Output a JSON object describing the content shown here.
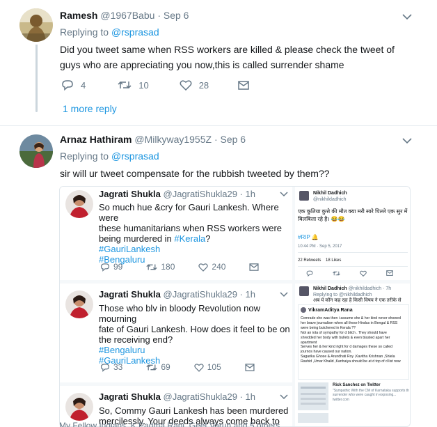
{
  "tweet1": {
    "name": "Ramesh",
    "handle": "@1967Babu",
    "date": "· Sep 6",
    "replying_prefix": "Replying to ",
    "replying_to": "@rsprasad",
    "text_line1": "Did you tweet same when RSS workers are killed & please check the tweet of",
    "text_line2": "guys who are appreciating you now,this is called surrender shame",
    "replies": "4",
    "retweets": "10",
    "likes": "28",
    "more_reply": "1 more reply"
  },
  "tweet2": {
    "name": "Arnaz Hathiram",
    "handle": "@Milkyway1955Z",
    "date": "· Sep 6",
    "replying_prefix": "Replying to ",
    "replying_to": "@rsprasad",
    "text": "sir will ur tweet compensate for the rubbish tweeted by them??"
  },
  "embed": {
    "card1": {
      "name": "Jagrati Shukla",
      "handle": "@JagratiShukla29 · 1h",
      "line1": "So much hue &cry for Gauri Lankesh. Where were",
      "line2": "these humanitarians when RSS workers were",
      "line3": "being murdered in ",
      "line3_tag": "#Kerala",
      "line3_end": "?",
      "tag1": "#GauriLankesh",
      "tag2": "#Bengaluru",
      "replies": "99",
      "retweets": "180",
      "likes": "240"
    },
    "card2": {
      "name": "Jagrati Shukla",
      "handle": "@JagratiShukla29 · 1h",
      "line1": "Those who blv in bloody Revolution now mourning",
      "line2": "fate of Gauri Lankesh. How does it feel to be on",
      "line3": "the receiving end?",
      "tag1": "#Bengaluru",
      "tag2": "#GauriLankesh",
      "replies": "33",
      "retweets": "69",
      "likes": "105"
    },
    "card3": {
      "name": "Jagrati Shukla",
      "handle": "@JagratiShukla29 · 1h",
      "line1": "So, Commy Gauri Lankesh has been murdered",
      "line2": "mercilessly. Your deeds always come back to"
    },
    "side1": {
      "name": "Nikhil Dadhich",
      "handle": "@nikhildadhich",
      "hindi1": "एक कुतिया कुत्ते की मौत क्या मरी सारे पिल्ले एक सुर में",
      "hindi2": "बिलबिला रहे है। 😂😂",
      "rip": "#RIP 🔔",
      "time": "10:44 PM · Sep 5, 2017",
      "retweets_label": "22 Retweets",
      "likes_label": "18 Likes"
    },
    "side2": {
      "name": "Nikhil Dadhich",
      "handle": "@nikhildadhich · 7h",
      "replying": "Replying to @nikhildadhich",
      "hindi": "अब ये कौन कह रहा है किसी विषय ने एक तरीके से",
      "inner_name": "VikramAditya Rana",
      "l1": "Comrade she was then i assume she & her kind never showed",
      "l2": "her brave journalism when all these Hindus in Bengal & RSS",
      "l3": "were being butchered in Kerala ??",
      "l4": "Not an iota of sympathy for d bitch . They should have",
      "l5": "shredded her body with bullets & even blasted apart her",
      "l6": "apartment",
      "l7": "Serves her & her kind right for d damages these so called",
      "l8": "journos have caused our nation.",
      "l9": "Sagarika Ghose & Arundhati Roy ,Kavitha Krishnan ,Shiela",
      "l10": "Rashid ,Umar Khalid ,Kanhaiya should be at d top of d list now",
      "rick_name": "Rick Sanchez on Twitter",
      "rick_l1": "\"Sympathic With the CM of Karnataka supports the",
      "rick_l2": "surrender who were caught in exposing...",
      "rick_l3": "twitter.com"
    }
  },
  "bottom_bar": "My Fellow Indians, K Padma Rani, Geet Varun and 5 others",
  "colors": {
    "link_blue": "#1b95e0",
    "muted_gray": "#657786",
    "border": "#e6ecf0"
  }
}
